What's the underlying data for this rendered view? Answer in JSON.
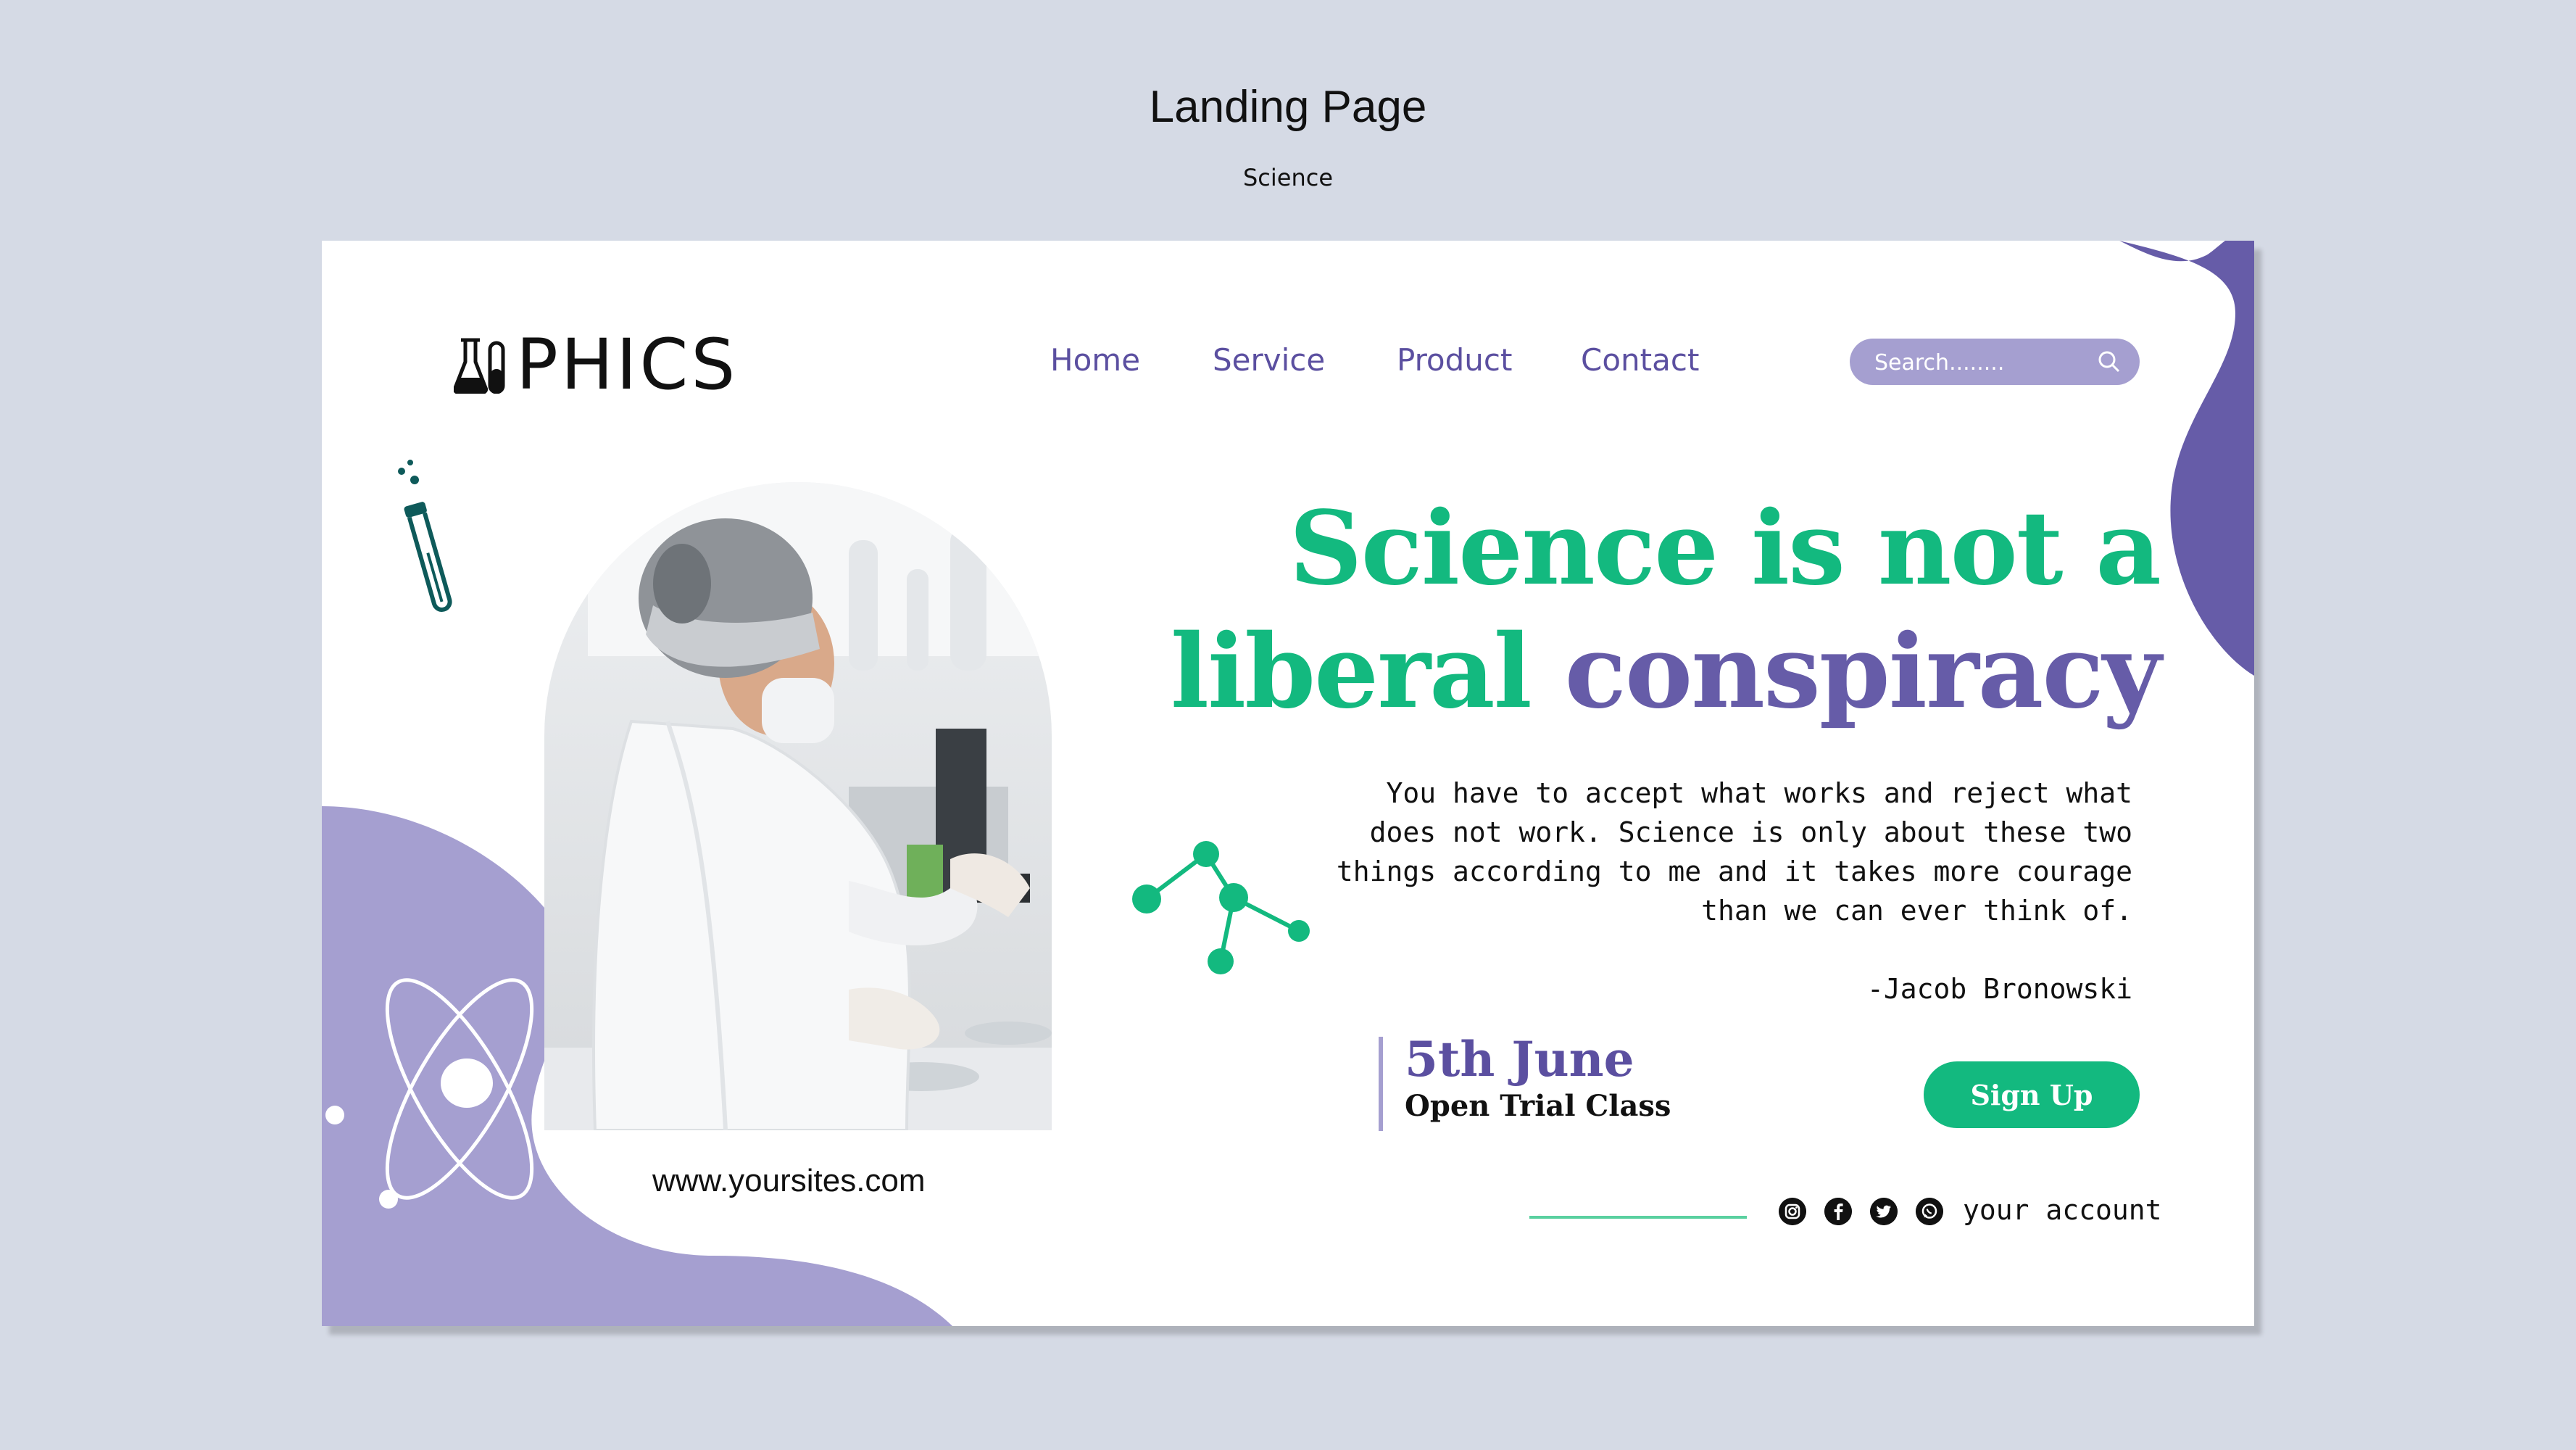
{
  "header": {
    "title": "Landing Page",
    "subtitle": "Science"
  },
  "brand": {
    "name": "PHICS",
    "icon": "lab-flask-icon"
  },
  "nav": {
    "items": [
      {
        "label": "Home"
      },
      {
        "label": "Service"
      },
      {
        "label": "Product"
      },
      {
        "label": "Contact"
      }
    ]
  },
  "search": {
    "placeholder": "Search........",
    "icon": "search-icon"
  },
  "hero": {
    "headline_line1": "Science is not a",
    "headline_line2_green": "liberal",
    "headline_line2_purple": "conspiracy",
    "quote": "You have to accept what works and reject what does not work. Science is only about these two things according to me and it takes more courage than we can ever think of.",
    "author": "-Jacob Bronowski",
    "photo": "scientist-photo"
  },
  "event": {
    "date": "5th June",
    "name": "Open Trial Class"
  },
  "cta": {
    "signup_label": "Sign Up"
  },
  "footer": {
    "website": "www.yoursites.com",
    "social_icons": [
      "instagram-icon",
      "facebook-icon",
      "twitter-icon",
      "whatsapp-icon"
    ],
    "account_label": "your account"
  },
  "colors": {
    "green": "#13b97f",
    "purple": "#665ca8",
    "lavender": "#a59fd0",
    "background": "#d5dae5"
  }
}
